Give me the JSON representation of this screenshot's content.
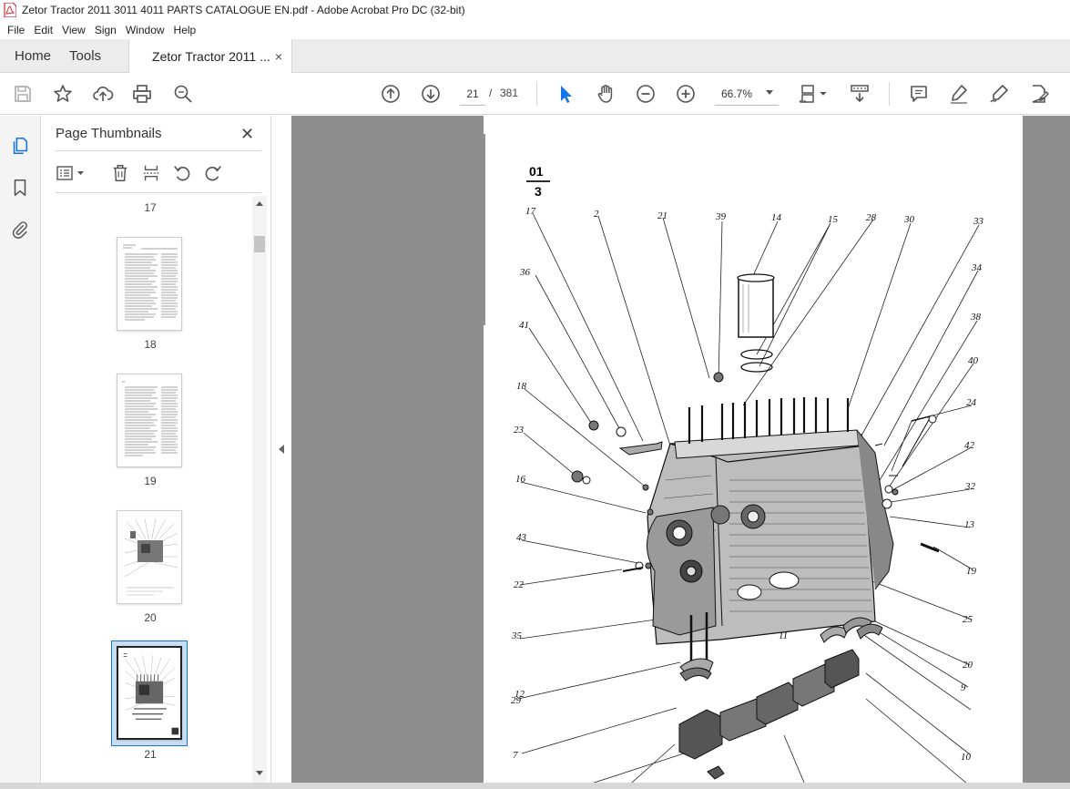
{
  "window": {
    "title": "Zetor Tractor 2011 3011 4011 PARTS CATALOGUE EN.pdf - Adobe Acrobat Pro DC (32-bit)",
    "app_icon": "acrobat-icon"
  },
  "menu": {
    "items": [
      "File",
      "Edit",
      "View",
      "Sign",
      "Window",
      "Help"
    ]
  },
  "tabs": {
    "home": "Home",
    "tools": "Tools",
    "document": "Zetor Tractor 2011 ...",
    "close_glyph": "×"
  },
  "toolbar": {
    "icons": [
      "save-icon",
      "bookmark-star-icon",
      "upload-icon",
      "print-icon",
      "zoom-search-icon",
      "page-up-icon",
      "page-down-icon",
      "select-cursor-icon",
      "hand-icon",
      "zoom-out-icon",
      "zoom-in-icon",
      "fit-page-icon",
      "scroll-mode-icon",
      "comment-icon",
      "highlight-icon",
      "sign-icon",
      "edit-pdf-icon"
    ],
    "current_page": "21",
    "page_separator": "/",
    "total_pages": "381",
    "zoom": "66.7%"
  },
  "panel": {
    "title": "Page Thumbnails",
    "close_glyph": "✕",
    "tools": [
      "options-menu-icon",
      "delete-icon",
      "insert-page-icon",
      "rotate-ccw-icon",
      "rotate-cw-icon"
    ],
    "thumbnails": [
      {
        "label": "17"
      },
      {
        "label": "18"
      },
      {
        "label": "19"
      },
      {
        "label": "20"
      },
      {
        "label": "21",
        "selected": true
      }
    ]
  },
  "page": {
    "section_top": "01",
    "section_bottom": "3",
    "callouts": [
      "17",
      "2",
      "21",
      "39",
      "14",
      "15",
      "28",
      "30",
      "33",
      "36",
      "34",
      "41",
      "38",
      "18",
      "40",
      "23",
      "24",
      "16",
      "42",
      "43",
      "32",
      "22",
      "13",
      "35",
      "19",
      "12",
      "25",
      "11",
      "20",
      "29",
      "9",
      "7",
      "10"
    ]
  },
  "colors": {
    "accent": "#1473e6",
    "acrobat_red": "#d7282f",
    "viewer_bg": "#8e8e8e"
  }
}
